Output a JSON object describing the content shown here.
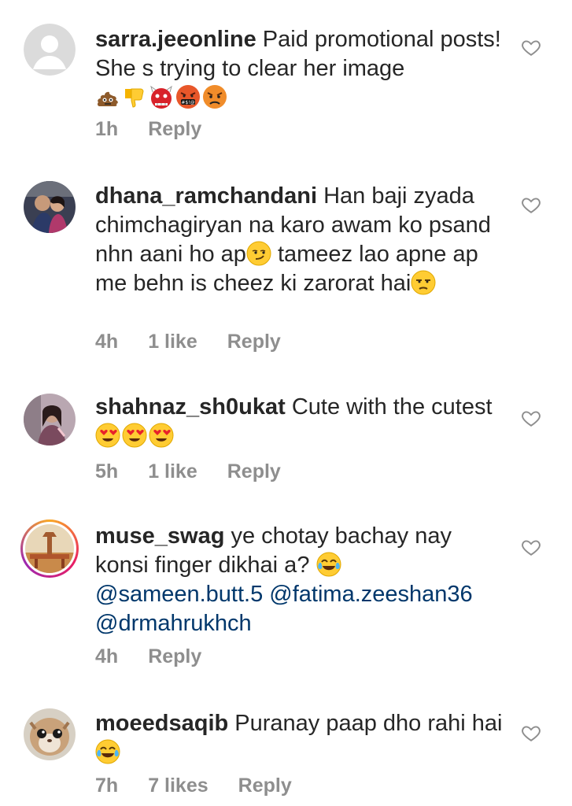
{
  "comments": [
    {
      "username": "sarra.jeeonline",
      "text": "Paid promotional posts! She s trying to clear her image",
      "emojis": [
        "pile-of-poo",
        "thumbs-down",
        "ogre",
        "face-with-symbols",
        "angry-face"
      ],
      "time": "1h",
      "likes": "",
      "reply": "Reply"
    },
    {
      "username": "dhana_ramchandani",
      "text_1": "Han baji zyada chimchagiryan na karo awam ko psand nhn aani ho ap",
      "emoji_1": "smirking-face",
      "text_2": " tameez lao apne ap me behn is cheez ki zarorat hai",
      "emoji_2": "unamused-face",
      "time": "4h",
      "likes": "1 like",
      "reply": "Reply"
    },
    {
      "username": "shahnaz_sh0ukat",
      "text": "Cute with the cutest",
      "emojis": [
        "heart-eyes",
        "heart-eyes",
        "heart-eyes"
      ],
      "time": "5h",
      "likes": "1 like",
      "reply": "Reply"
    },
    {
      "username": "muse_swag",
      "text": "ye chotay bachay nay konsi finger dikhai a?",
      "emoji": "tears-of-joy",
      "mentions": [
        "@sameen.butt.5",
        "@fatima.zeeshan36",
        "@drmahrukhch"
      ],
      "time": "4h",
      "likes": "",
      "reply": "Reply"
    },
    {
      "username": "moeedsaqib",
      "text": "Puranay paap dho rahi hai",
      "emoji": "tears-of-joy",
      "time": "7h",
      "likes": "7 likes",
      "reply": "Reply"
    }
  ],
  "colors": {
    "text": "#262626",
    "meta": "#8e8e8e",
    "mention": "#00376b"
  }
}
